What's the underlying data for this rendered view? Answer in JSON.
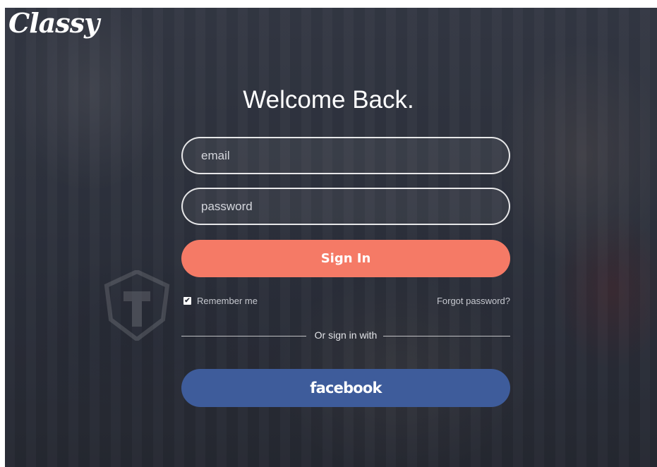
{
  "brand": {
    "logo_text": "Classy"
  },
  "login": {
    "heading": "Welcome Back.",
    "email_placeholder": "email",
    "password_placeholder": "password",
    "signin_label": "Sign In",
    "remember_label": "Remember me",
    "remember_checked": true,
    "forgot_label": "Forgot password?",
    "divider_text": "Or sign in with",
    "facebook_label": "facebook"
  },
  "colors": {
    "signin_button": "#f57a66",
    "facebook_button": "#3e5c9b"
  },
  "icons": {
    "checkbox": "checkmark-icon"
  }
}
